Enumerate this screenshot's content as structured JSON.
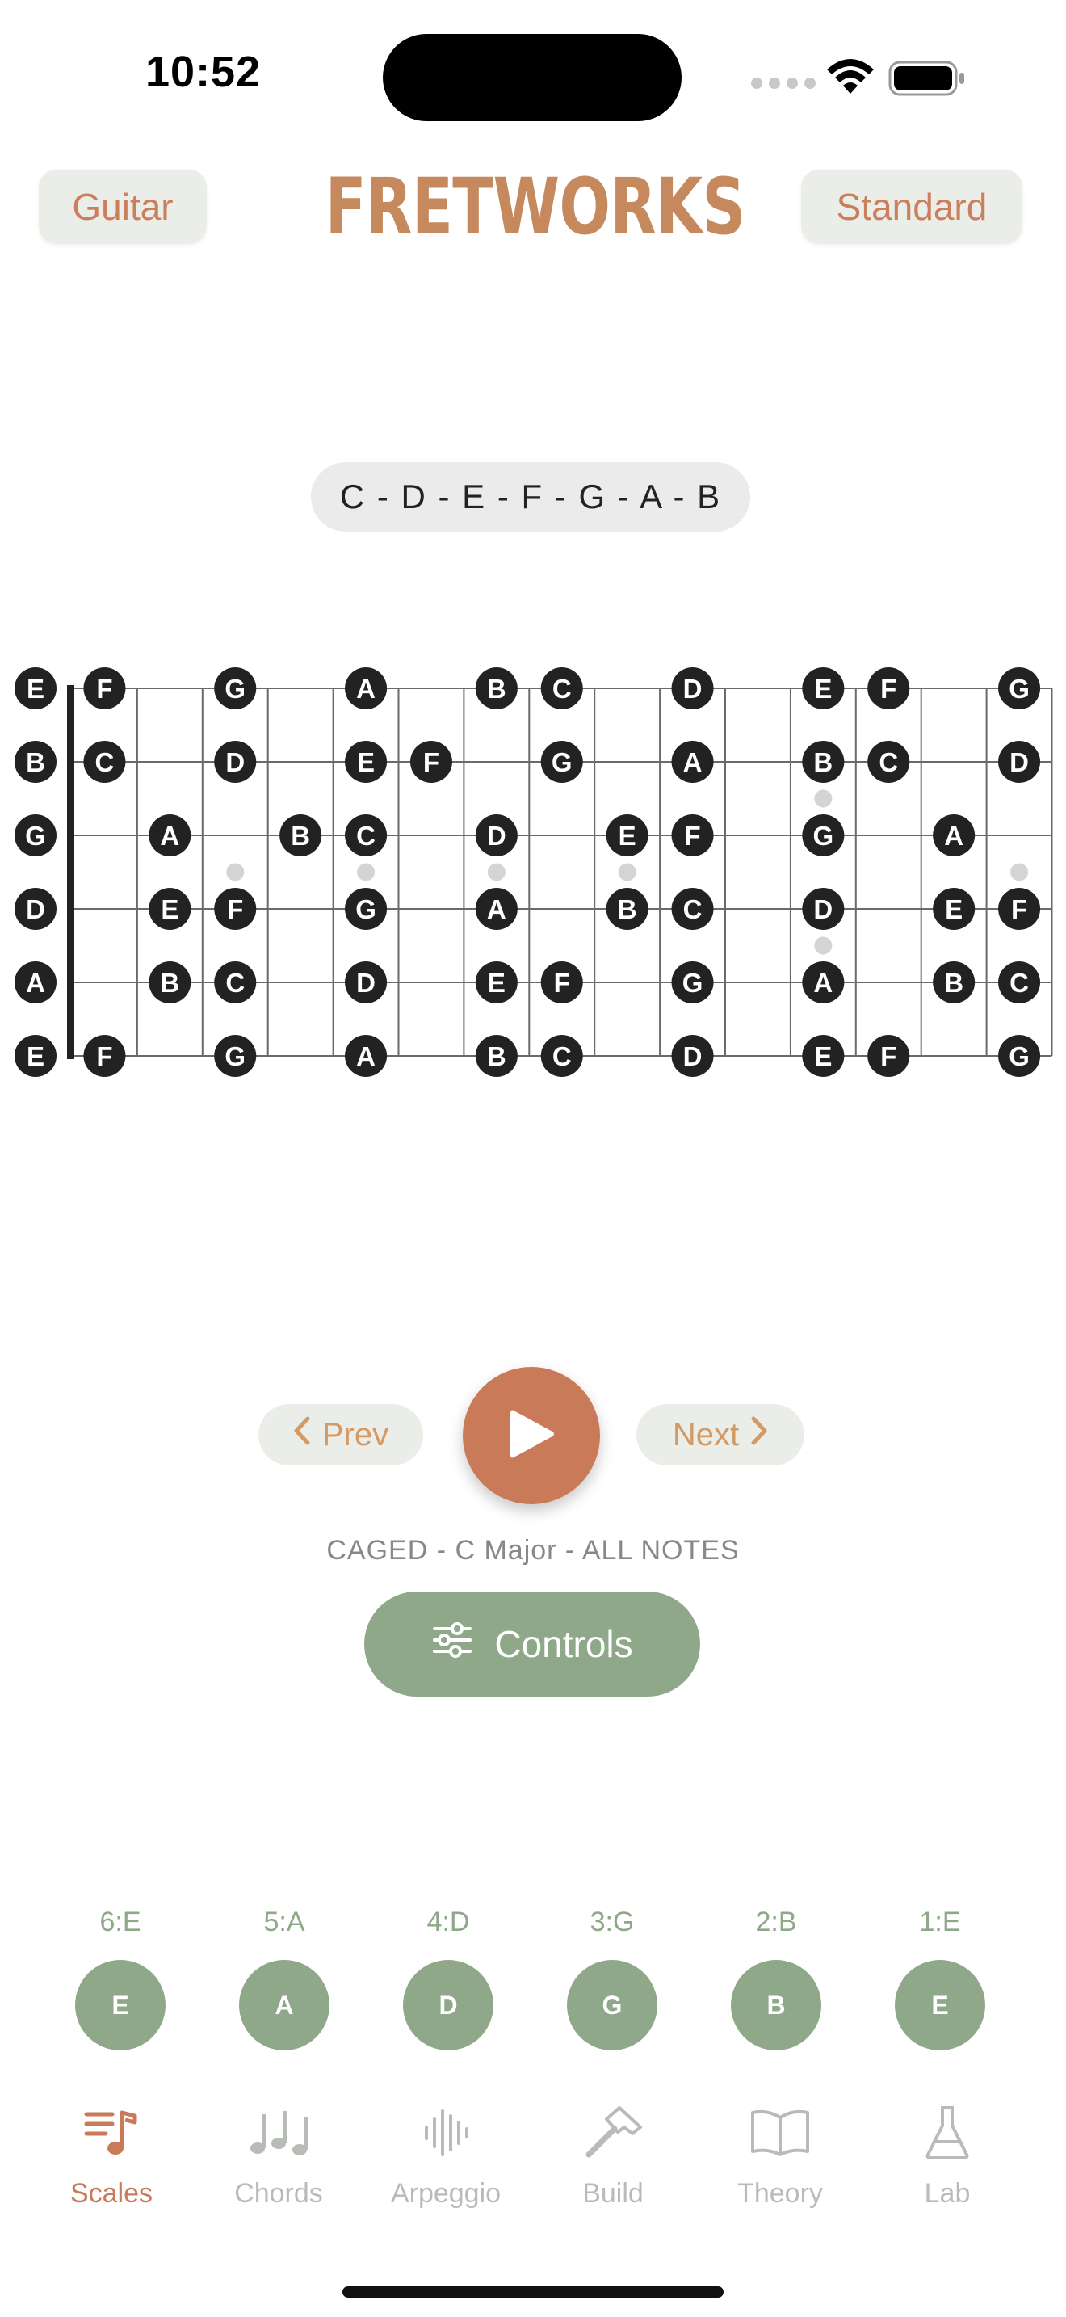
{
  "status_bar": {
    "time": "10:52"
  },
  "header": {
    "instrument_label": "Guitar",
    "title": "FRETWORKS",
    "tuning_label": "Standard"
  },
  "scale_notes": "C - D - E - F - G - A - B",
  "fretboard": {
    "open_strings": [
      "E",
      "B",
      "G",
      "D",
      "A",
      "E"
    ],
    "rows": [
      [
        "F",
        "",
        "G",
        "",
        "A",
        "",
        "B",
        "C",
        "",
        "D",
        "",
        "E",
        "F",
        "",
        "G"
      ],
      [
        "C",
        "",
        "D",
        "",
        "E",
        "F",
        "",
        "G",
        "",
        "A",
        "",
        "B",
        "C",
        "",
        "D"
      ],
      [
        "",
        "A",
        "",
        "B",
        "C",
        "",
        "D",
        "",
        "E",
        "F",
        "",
        "G",
        "",
        "A",
        ""
      ],
      [
        "",
        "E",
        "F",
        "",
        "G",
        "",
        "A",
        "",
        "B",
        "C",
        "",
        "D",
        "",
        "E",
        "F"
      ],
      [
        "",
        "B",
        "C",
        "",
        "D",
        "",
        "E",
        "F",
        "",
        "G",
        "",
        "A",
        "",
        "B",
        "C"
      ],
      [
        "F",
        "",
        "G",
        "",
        "A",
        "",
        "B",
        "C",
        "",
        "D",
        "",
        "E",
        "F",
        "",
        "G"
      ]
    ]
  },
  "transport": {
    "prev_label": "Prev",
    "next_label": "Next",
    "caption": "CAGED - C Major - ALL NOTES",
    "controls_label": "Controls"
  },
  "strings": [
    {
      "label": "6:E",
      "note": "E"
    },
    {
      "label": "5:A",
      "note": "A"
    },
    {
      "label": "4:D",
      "note": "D"
    },
    {
      "label": "3:G",
      "note": "G"
    },
    {
      "label": "2:B",
      "note": "B"
    },
    {
      "label": "1:E",
      "note": "E"
    }
  ],
  "tabs": [
    {
      "label": "Scales",
      "icon": "scales-icon",
      "active": true
    },
    {
      "label": "Chords",
      "icon": "chords-icon",
      "active": false
    },
    {
      "label": "Arpeggio",
      "icon": "arpeggio-icon",
      "active": false
    },
    {
      "label": "Build",
      "icon": "hammer-icon",
      "active": false
    },
    {
      "label": "Theory",
      "icon": "book-icon",
      "active": false
    },
    {
      "label": "Lab",
      "icon": "flask-icon",
      "active": false
    }
  ],
  "colors": {
    "accent": "#c97a58",
    "title": "#c5895d",
    "sage": "#8fa889",
    "pill_bg": "#ebeee8",
    "note_fill": "#222222"
  }
}
